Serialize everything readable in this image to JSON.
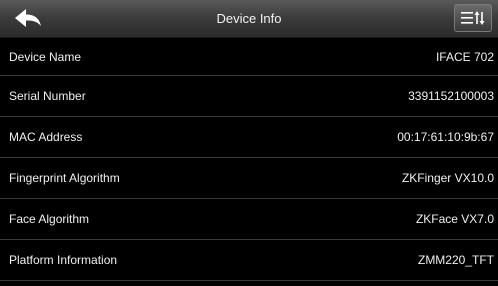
{
  "header": {
    "title": "Device Info",
    "back_icon": "back-arrow-icon",
    "menu_icon": "sort-menu-icon"
  },
  "rows": [
    {
      "label": "Device Name",
      "value": "IFACE 702"
    },
    {
      "label": "Serial Number",
      "value": "3391152100003"
    },
    {
      "label": "MAC Address",
      "value": "00:17:61:10:9b:67"
    },
    {
      "label": "Fingerprint Algorithm",
      "value": "ZKFinger VX10.0"
    },
    {
      "label": "Face Algorithm",
      "value": "ZKFace VX7.0"
    },
    {
      "label": "Platform Information",
      "value": "ZMM220_TFT"
    }
  ],
  "colors": {
    "background": "#000000",
    "header": "#3d3d3d",
    "divider": "#3a3a3a",
    "text": "#f0f0f0"
  }
}
